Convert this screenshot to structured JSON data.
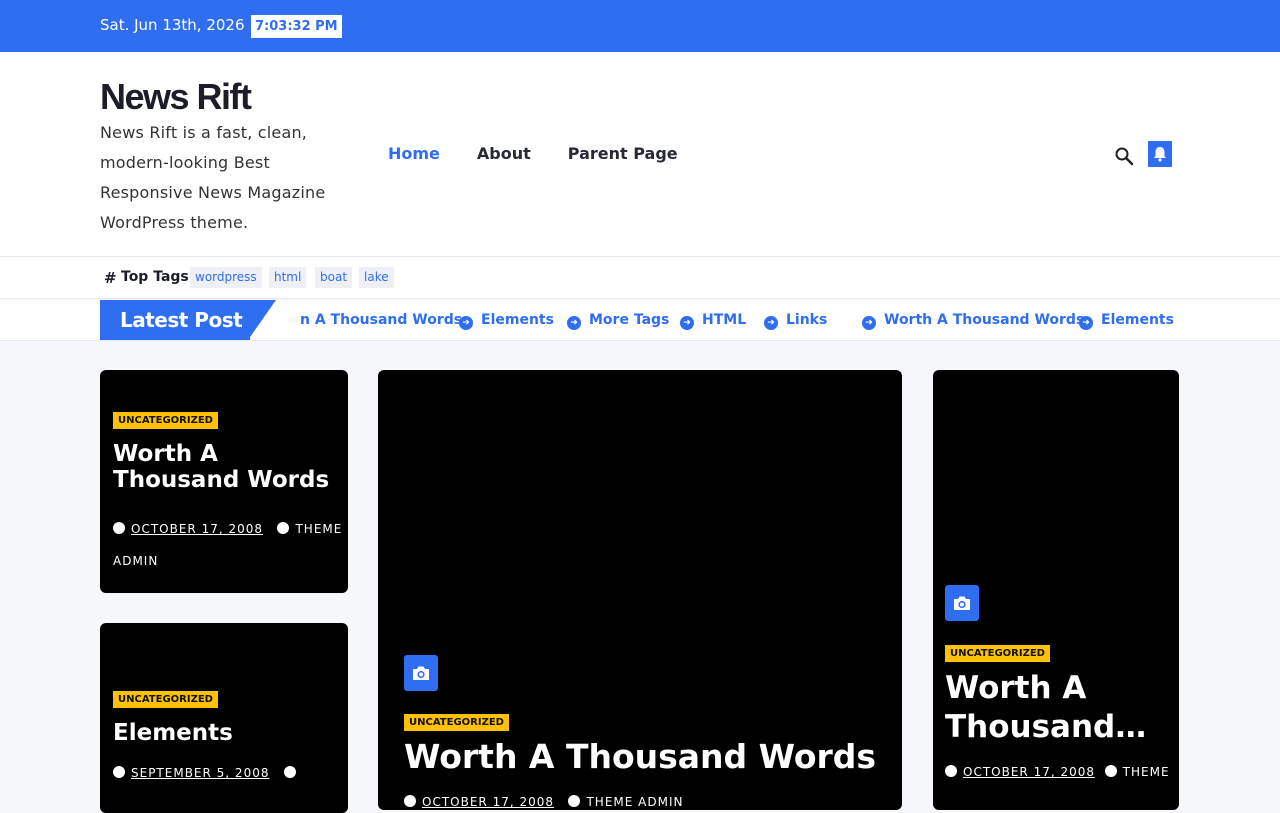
{
  "topbar": {
    "date": "Sat. Jun 13th, 2026",
    "time": "7:03:32 PM"
  },
  "site": {
    "name": "News Rift",
    "tagline": "News Rift is a fast, clean, modern-looking Best Responsive News Magazine WordPress theme."
  },
  "nav": {
    "items": [
      {
        "label": "Home"
      },
      {
        "label": "About"
      },
      {
        "label": "Parent Page"
      }
    ]
  },
  "top_tags": {
    "label": "Top Tags",
    "tags": [
      "wordpress",
      "html",
      "boat",
      "lake"
    ]
  },
  "ticker": {
    "label": "Latest Post",
    "items": [
      "n A Thousand Words",
      "Elements",
      "More Tags",
      "HTML",
      "Links",
      "Worth A Thousand Words",
      "Elements"
    ]
  },
  "posts": {
    "left1": {
      "category": "UNCATEGORIZED",
      "title": "Worth A Thousand Words",
      "date": "OCTOBER 17, 2008",
      "author": "THEME ADMIN"
    },
    "left2": {
      "category": "UNCATEGORIZED",
      "title": "Elements",
      "date": "SEPTEMBER 5, 2008"
    },
    "main": {
      "category": "UNCATEGORIZED",
      "title": "Worth A Thousand Words",
      "date": "OCTOBER 17, 2008",
      "author": "THEME ADMIN"
    },
    "right": {
      "category": "UNCATEGORIZED",
      "title": "Worth A Thousand…",
      "date": "OCTOBER 17, 2008",
      "author": "THEME"
    }
  },
  "colors": {
    "accent": "#2f6ef0",
    "badge": "#ffc107"
  }
}
